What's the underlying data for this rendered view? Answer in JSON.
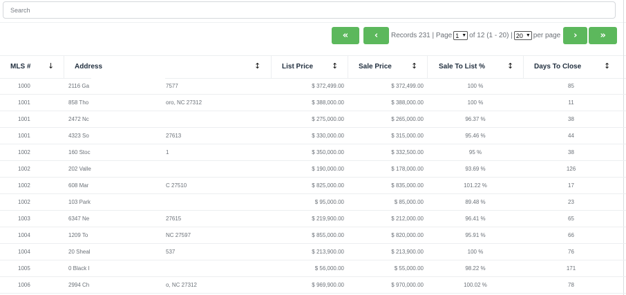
{
  "search": {
    "placeholder": "Search"
  },
  "pager": {
    "first": "«",
    "prev": "‹",
    "records_text": "Records 231 | Page",
    "page_value": "1",
    "of_text": "of 12 (1 - 20) |",
    "per_page_value": "20",
    "per_page_text": "per page",
    "next": "›",
    "last": "»"
  },
  "columns": [
    {
      "label": "MLS #",
      "sort": "↓"
    },
    {
      "label": "Address",
      "sort": "↕"
    },
    {
      "label": "List Price",
      "sort": "↕"
    },
    {
      "label": "Sale Price",
      "sort": "↕"
    },
    {
      "label": "Sale To List %",
      "sort": "↕"
    },
    {
      "label": "Days To Close",
      "sort": "↕"
    }
  ],
  "rows": [
    {
      "mls": "1000",
      "addr_left": "2116 Ga",
      "addr_right": "7577",
      "list": "$ 372,499.00",
      "sale": "$ 372,499.00",
      "ratio": "100 %",
      "days": "85"
    },
    {
      "mls": "1001",
      "addr_left": "858 Tho",
      "addr_right": "oro, NC 27312",
      "list": "$ 388,000.00",
      "sale": "$ 388,000.00",
      "ratio": "100 %",
      "days": "11"
    },
    {
      "mls": "1001",
      "addr_left": "2472 Nc",
      "addr_right": "",
      "list": "$ 275,000.00",
      "sale": "$ 265,000.00",
      "ratio": "96.37 %",
      "days": "38"
    },
    {
      "mls": "1001",
      "addr_left": "4323 So",
      "addr_right": "27613",
      "list": "$ 330,000.00",
      "sale": "$ 315,000.00",
      "ratio": "95.46 %",
      "days": "44"
    },
    {
      "mls": "1002",
      "addr_left": "160 Stoc",
      "addr_right": "1",
      "list": "$ 350,000.00",
      "sale": "$ 332,500.00",
      "ratio": "95 %",
      "days": "38"
    },
    {
      "mls": "1002",
      "addr_left": "202 Valle",
      "addr_right": "",
      "list": "$ 190,000.00",
      "sale": "$ 178,000.00",
      "ratio": "93.69 %",
      "days": "126"
    },
    {
      "mls": "1002",
      "addr_left": "608 Mar",
      "addr_right": "C 27510",
      "list": "$ 825,000.00",
      "sale": "$ 835,000.00",
      "ratio": "101.22 %",
      "days": "17"
    },
    {
      "mls": "1002",
      "addr_left": "103 Park",
      "addr_right": "",
      "list": "$ 95,000.00",
      "sale": "$ 85,000.00",
      "ratio": "89.48 %",
      "days": "23"
    },
    {
      "mls": "1003",
      "addr_left": "6347 Ne",
      "addr_right": "27615",
      "list": "$ 219,900.00",
      "sale": "$ 212,000.00",
      "ratio": "96.41 %",
      "days": "65"
    },
    {
      "mls": "1004",
      "addr_left": "1209 To",
      "addr_right": "NC 27597",
      "list": "$ 855,000.00",
      "sale": "$ 820,000.00",
      "ratio": "95.91 %",
      "days": "66"
    },
    {
      "mls": "1004",
      "addr_left": "20 Sheal",
      "addr_right": "537",
      "list": "$ 213,900.00",
      "sale": "$ 213,900.00",
      "ratio": "100 %",
      "days": "76"
    },
    {
      "mls": "1005",
      "addr_left": "0 Black I",
      "addr_right": "",
      "list": "$ 56,000.00",
      "sale": "$ 55,000.00",
      "ratio": "98.22 %",
      "days": "171"
    },
    {
      "mls": "1006",
      "addr_left": "2994 Ch",
      "addr_right": "o, NC 27312",
      "list": "$ 969,900.00",
      "sale": "$ 970,000.00",
      "ratio": "100.02 %",
      "days": "78"
    }
  ]
}
